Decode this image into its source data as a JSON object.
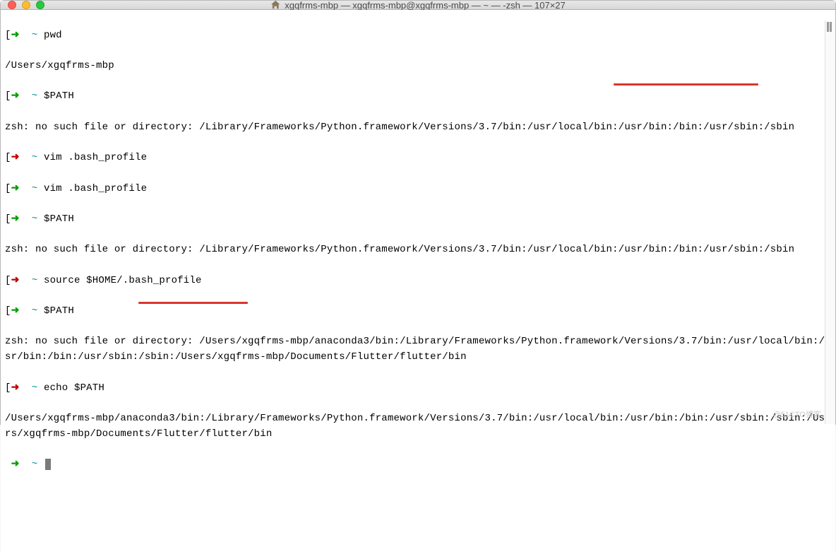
{
  "titlebar": {
    "title": "xgqfrms-mbp — xgqfrms-mbp@xgqfrms-mbp — ~ — -zsh — 107×27"
  },
  "lines": {
    "l1_cmd": "pwd",
    "l2": "/Users/xgqfrms-mbp",
    "l3_cmd": "$PATH",
    "l4": "zsh: no such file or directory: /Library/Frameworks/Python.framework/Versions/3.7/bin:/usr/local/bin:/usr/bin:/bin:/usr/sbin:/sbin",
    "l5_cmd": "vim .bash_profile",
    "l6_cmd": "vim .bash_profile",
    "l7_cmd": "$PATH",
    "l8": "zsh: no such file or directory: /Library/Frameworks/Python.framework/Versions/3.7/bin:/usr/local/bin:/usr/bin:/bin:/usr/sbin:/sbin",
    "l9_cmd": "source $HOME/.bash_profile",
    "l10_cmd": "$PATH",
    "l11": "zsh: no such file or directory: /Users/xgqfrms-mbp/anaconda3/bin:/Library/Frameworks/Python.framework/Versions/3.7/bin:/usr/local/bin:/usr/bin:/bin:/usr/sbin:/sbin:/Users/xgqfrms-mbp/Documents/Flutter/flutter/bin",
    "l12_cmd": "echo $PATH",
    "l13": "/Users/xgqfrms-mbp/anaconda3/bin:/Library/Frameworks/Python.framework/Versions/3.7/bin:/usr/local/bin:/usr/bin:/bin:/usr/sbin:/sbin:/Users/xgqfrms-mbp/Documents/Flutter/flutter/bin"
  },
  "prompt": {
    "open": "[",
    "close": "]",
    "arrow": "➜",
    "tilde": "~"
  },
  "watermark": "@51CTO博客",
  "colors": {
    "arrow_green": "#00a000",
    "arrow_red": "#c00000",
    "tilde": "#009090",
    "underline": "#d9362e"
  }
}
